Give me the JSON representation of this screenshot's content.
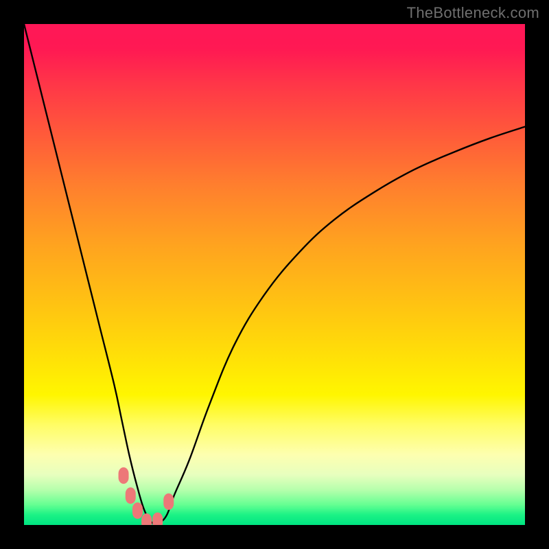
{
  "watermark": "TheBottleneck.com",
  "chart_data": {
    "type": "line",
    "title": "",
    "xlabel": "",
    "ylabel": "",
    "xlim": [
      0,
      100
    ],
    "ylim": [
      0,
      100
    ],
    "grid": false,
    "curve_x": [
      0,
      3,
      6,
      9,
      12,
      15,
      18,
      19.5,
      21,
      22.5,
      24,
      25.5,
      27,
      28.5,
      30,
      33,
      37,
      42,
      48,
      55,
      62,
      70,
      78,
      86,
      93,
      100
    ],
    "curve_y": [
      100,
      88,
      76,
      64,
      52,
      40,
      28,
      21,
      14,
      8,
      3,
      0.5,
      0.5,
      2,
      6,
      13,
      24,
      36,
      46,
      54.5,
      61,
      66.5,
      71,
      74.5,
      77.2,
      79.5
    ],
    "series": [
      {
        "name": "markers",
        "x": [
          19.8,
          21.2,
          22.6,
          24.4,
          26.6,
          28.8
        ],
        "y": [
          10.0,
          6.0,
          3.0,
          0.8,
          1.0,
          4.8
        ]
      }
    ],
    "marker_color": "#ed7878",
    "curve_control_scale": 0.38
  }
}
